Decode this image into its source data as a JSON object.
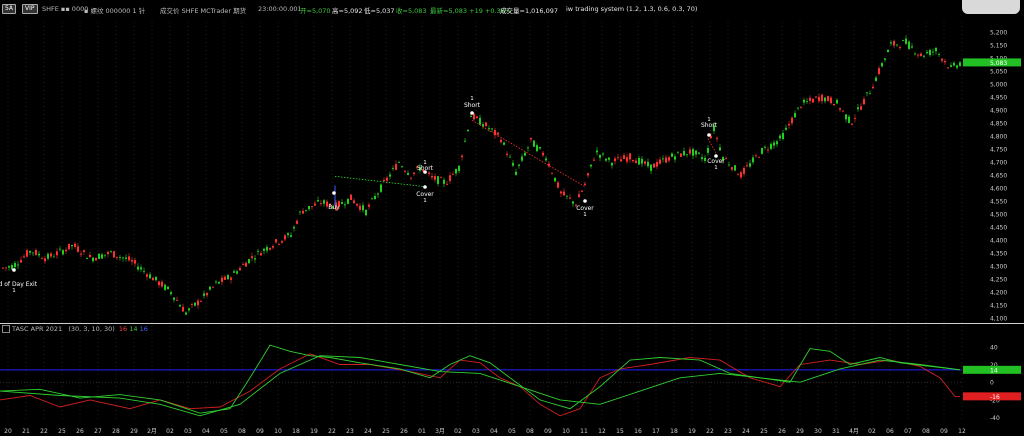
{
  "header": {
    "badge1": "5A",
    "badge2": "VIP",
    "symbol": "SHFE ▪▪ 0000",
    "code": "▪ 螺纹 000000 1 针",
    "contract": "成交价 SHFE MCTrader 期货",
    "time": "23:00:00.001",
    "open": "开=5,070",
    "high": "高=5,092",
    "low": "低=5,037",
    "close": "收=5,083",
    "last": "最新=5,083 +19 +0.38%",
    "volume": "成交量=1,016,097",
    "strategy": "iw trading system (1.2, 1.3, 0.6, 0.3, 70)"
  },
  "indicator": {
    "title": "TASC APR 2021",
    "params": "(30, 3, 10, 30)",
    "v1": "16",
    "v2": "14",
    "v3": "16",
    "axis": [
      "40",
      "20",
      "0",
      "-20",
      "-40"
    ],
    "badge_green": "14",
    "badge_red": "-16"
  },
  "price_axis": [
    "5,200",
    "5,150",
    "5,100",
    "5,050",
    "5,000",
    "4,950",
    "4,900",
    "4,850",
    "4,800",
    "4,750",
    "4,700",
    "4,650",
    "4,600",
    "4,550",
    "4,500",
    "4,450",
    "4,400",
    "4,350",
    "4,300",
    "4,250",
    "4,200",
    "4,150",
    "4,100"
  ],
  "price_badge": "5,083",
  "date_axis": [
    "20",
    "21",
    "22",
    "25",
    "26",
    "27",
    "28",
    "29",
    "2月",
    "02",
    "03",
    "04",
    "05",
    "08",
    "09",
    "10",
    "18",
    "19",
    "22",
    "23",
    "24",
    "25",
    "26",
    "01",
    "3月",
    "02",
    "03",
    "04",
    "05",
    "08",
    "09",
    "10",
    "11",
    "12",
    "15",
    "16",
    "17",
    "18",
    "19",
    "22",
    "23",
    "24",
    "25",
    "26",
    "29",
    "30",
    "31",
    "4月",
    "02",
    "06",
    "07",
    "08",
    "09",
    "12"
  ],
  "signals": [
    {
      "text": "End of Day Exit",
      "n": "1"
    },
    {
      "text": "Buy",
      "n": "1"
    },
    {
      "text": "Short",
      "n": "1"
    },
    {
      "text": "Cover",
      "n": "1"
    },
    {
      "text": "Short",
      "n": "1"
    },
    {
      "text": "Cover",
      "n": "1"
    },
    {
      "text": "Short",
      "n": "1"
    },
    {
      "text": "Cover",
      "n": "1"
    }
  ],
  "colors": {
    "up": "#ff3030",
    "down": "#20d020",
    "axis": "#cccccc",
    "blue": "#2020ff"
  }
}
